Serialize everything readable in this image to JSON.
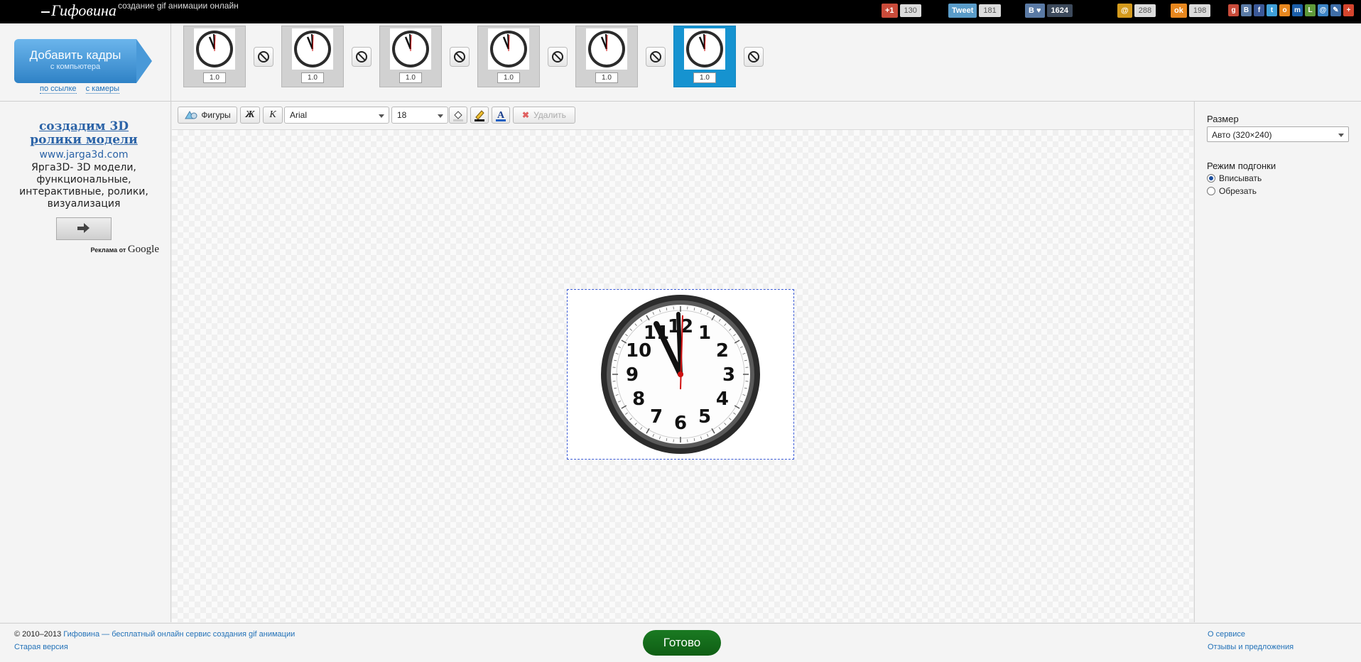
{
  "header": {
    "logo": "Гифовина",
    "tagline": "создание gif анимации онлайн",
    "share": {
      "gplus_label": "+1",
      "gplus_count": "130",
      "tweet_label": "Tweet",
      "tweet_count": "181",
      "vk_count": "1624",
      "mail_count": "288",
      "ok_count": "198"
    },
    "social_icons": [
      "gplus-icon",
      "vk-icon",
      "facebook-icon",
      "twitter-icon",
      "odnoklassniki-icon",
      "mailru-icon",
      "liveinternet-icon",
      "email-icon",
      "livejournal-icon",
      "plus-icon"
    ]
  },
  "frames_bar": {
    "add_button_title": "Добавить кадры",
    "add_button_sub": "с компьютера",
    "link_url": "по ссылке",
    "link_camera": "с камеры",
    "frames": [
      {
        "delay": "1.0",
        "selected": false
      },
      {
        "delay": "1.0",
        "selected": false
      },
      {
        "delay": "1.0",
        "selected": false
      },
      {
        "delay": "1.0",
        "selected": false
      },
      {
        "delay": "1.0",
        "selected": false
      },
      {
        "delay": "1.0",
        "selected": true
      }
    ]
  },
  "ad": {
    "title": "создадим 3D ролики модели",
    "url": "www.jarga3d.com",
    "text": "Ярга3D- 3D модели, функциональные, интерактивные, ролики, визуализация",
    "attribution_prefix": "Реклама от",
    "attribution_brand": "Google"
  },
  "toolbar": {
    "shapes": "Фигуры",
    "bold": "Ж",
    "italic": "К",
    "font": "Arial",
    "size": "18",
    "delete": "Удалить"
  },
  "settings": {
    "size_label": "Размер",
    "size_value": "Авто (320×240)",
    "fit_label": "Режим подгонки",
    "fit_options": [
      "Вписывать",
      "Обрезать"
    ],
    "fit_selected": "Вписывать"
  },
  "footer": {
    "copyright": "© 2010–2013",
    "site_link": "Гифовина — бесплатный онлайн сервис создания gif анимации",
    "old_version": "Старая версия",
    "done": "Готово",
    "about": "О сервисе",
    "feedback": "Отзывы и предложения"
  },
  "clock_numbers": [
    "12",
    "1",
    "2",
    "3",
    "4",
    "5",
    "6",
    "7",
    "8",
    "9",
    "10",
    "11"
  ]
}
